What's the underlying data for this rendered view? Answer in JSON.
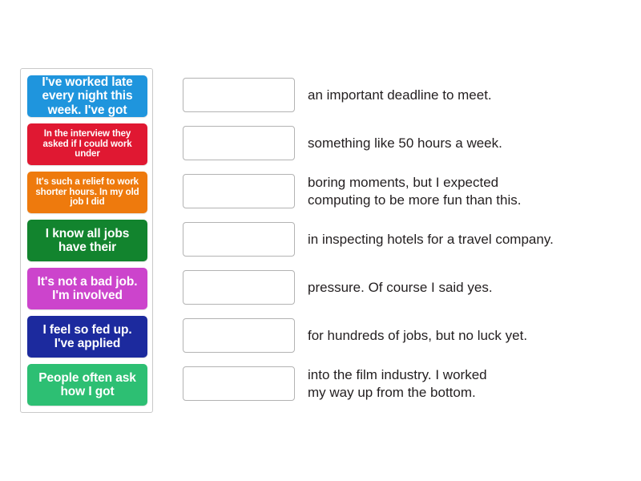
{
  "activity": {
    "type": "match-up",
    "tray_label": "sentence-starter-tiles",
    "tiles": [
      {
        "text": "I've worked late every night this week. I've got",
        "color": "#1f95dd",
        "lines": 2
      },
      {
        "text": "In the interview they asked if I could work under",
        "color": "#e01832",
        "lines": 3
      },
      {
        "text": "It's such a relief to work shorter hours. In my old job I did",
        "color": "#ee7a0d",
        "lines": 3
      },
      {
        "text": "I know all jobs have their",
        "color": "#12842e",
        "lines": 2
      },
      {
        "text": "It's not a bad job. I'm involved",
        "color": "#cc44cc",
        "lines": 2
      },
      {
        "text": "I feel so fed up. I've applied",
        "color": "#1c2a9e",
        "lines": 2
      },
      {
        "text": "People often ask how I got",
        "color": "#2dbf73",
        "lines": 2
      }
    ],
    "answers": [
      {
        "text": "an important deadline to meet.",
        "slot_value": ""
      },
      {
        "text": "something like 50 hours a week.",
        "slot_value": ""
      },
      {
        "text": "boring moments, but I expected\ncomputing to be more fun than this.",
        "slot_value": ""
      },
      {
        "text": "in inspecting hotels for a travel company.",
        "slot_value": ""
      },
      {
        "text": "pressure. Of course I said yes.",
        "slot_value": ""
      },
      {
        "text": "for hundreds of jobs, but no luck yet.",
        "slot_value": ""
      },
      {
        "text": "into the film industry. I worked\nmy way up from the bottom.",
        "slot_value": ""
      }
    ],
    "colors": {
      "page_background": "#ffffff",
      "tray_border": "#c9c9c9",
      "slot_border": "#b3b3b3",
      "answer_text": "#231f20",
      "tile_text": "#ffffff"
    }
  }
}
